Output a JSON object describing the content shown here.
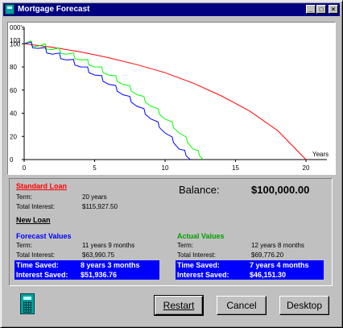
{
  "window": {
    "title": "Mortgage Forecast",
    "controls": [
      "_",
      "□",
      "×"
    ]
  },
  "chart_data": {
    "type": "line",
    "ylabel": "000's",
    "xlabel": "Years",
    "xlim": [
      0,
      20
    ],
    "ylim": [
      0,
      103
    ],
    "x_ticks": [
      "0",
      "5",
      "10",
      "15",
      "20"
    ],
    "y_ticks": [
      "0",
      "20",
      "40",
      "60",
      "80",
      "100"
    ],
    "y_top_label": "103",
    "series": [
      {
        "color": "#ff0000",
        "x": [
          0,
          2,
          4,
          6,
          8,
          10,
          12,
          14,
          16,
          18,
          20
        ],
        "y": [
          100,
          97,
          93,
          88,
          82,
          75,
          66,
          55,
          42,
          25,
          0
        ]
      },
      {
        "color": "#00ff00",
        "x": [
          0,
          1,
          2,
          3,
          4,
          5,
          6,
          7,
          8,
          9,
          10,
          11,
          12,
          12.7
        ],
        "y": [
          100,
          98,
          95,
          91,
          86,
          80,
          73,
          65,
          56,
          46,
          35,
          23,
          9,
          0
        ]
      },
      {
        "color": "#0000ff",
        "x": [
          0,
          1,
          2,
          3,
          4,
          5,
          6,
          7,
          8,
          9,
          10,
          11,
          11.8
        ],
        "y": [
          100,
          96,
          91,
          86,
          80,
          73,
          65,
          56,
          46,
          35,
          23,
          9,
          0
        ]
      }
    ]
  },
  "summary": {
    "standard_title": "Standard Loan",
    "term_label": "Term:",
    "interest_label": "Total Interest:",
    "standard_term": "20 years",
    "standard_interest": "$115,927.50",
    "balance_label": "Balance:",
    "balance_value": "$100,000.00",
    "new_loan_title": "New Loan",
    "forecast_title": "Forecast Values",
    "forecast_term": "11 years 9 months",
    "forecast_interest": "$63,990.75",
    "actual_title": "Actual Values",
    "actual_term": "12 years 8 months",
    "actual_interest": "$69,776.20",
    "time_saved_label": "Time Saved:",
    "interest_saved_label": "Interest Saved:",
    "forecast_time_saved": "8 years 3 months",
    "forecast_interest_saved": "$51,936.76",
    "actual_time_saved": "7 years 4 months",
    "actual_interest_saved": "$46,151.30"
  },
  "buttons": {
    "restart": "Restart",
    "cancel": "Cancel",
    "desktop": "Desktop"
  },
  "icons": {
    "title": "calculator-icon",
    "footer": "calculator-icon"
  }
}
